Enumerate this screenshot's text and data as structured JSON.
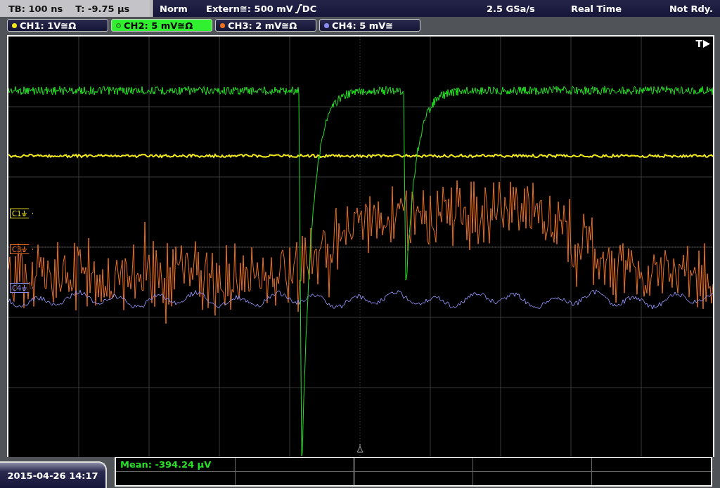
{
  "status_bar": {
    "timebase": "TB: 100 ns",
    "trigger_time": "T: -9.75 µs",
    "trigger_mode": "Norm",
    "trigger_source": "Extern≅: 500 mV",
    "coupling": "DC",
    "sample_rate": "2.5 GSa/s",
    "acquisition": "Real Time",
    "state": "Not Rdy."
  },
  "channels": [
    {
      "label": "CH1: 1V≅Ω",
      "color": "#f0e818",
      "selected": false,
      "marker": "C1"
    },
    {
      "label": "CH2: 5 mV≅Ω",
      "color": "#22e022",
      "selected": true
    },
    {
      "label": "CH3: 2 mV≅Ω",
      "color": "#f07020",
      "selected": false,
      "marker": "C3"
    },
    {
      "label": "CH4: 5 mV≅",
      "color": "#8c8cf0",
      "selected": false,
      "marker": "C4"
    }
  ],
  "trigger_marker": "T",
  "measurements": [
    {
      "text": "Mean: -394.24 µV"
    }
  ],
  "date": "2015-04-26 14:17"
}
